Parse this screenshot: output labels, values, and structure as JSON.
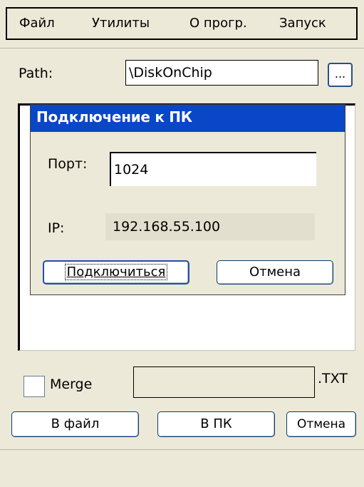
{
  "menu": {
    "items": [
      "Файл",
      "Утилиты",
      "О прогр.",
      "Запуск"
    ]
  },
  "path": {
    "label": "Path:",
    "value": "\\DiskOnChip",
    "browse_label": "..."
  },
  "dialog": {
    "title": "Подключение к ПК",
    "port_label": "Порт:",
    "port_value": "1024",
    "ip_label": "IP:",
    "ip_value": "192.168.55.100",
    "connect_label": "Подключиться",
    "cancel_label": "Отмена"
  },
  "bottom": {
    "merge_label": "Merge",
    "merge_checked": false,
    "extension": ".TXT",
    "to_file_label": "В файл",
    "to_pc_label": "В ПК",
    "cancel_label": "Отмена"
  },
  "colors": {
    "title_bar": "#0a46c8",
    "window_bg": "#ece9d8"
  }
}
